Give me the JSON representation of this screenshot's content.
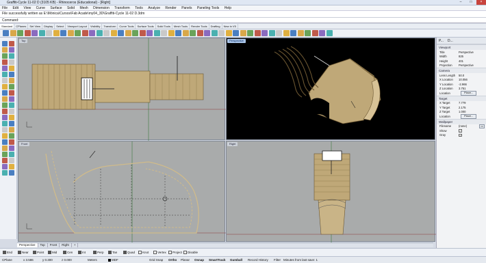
{
  "window": {
    "title": "Graffiti-Cycle 11-02 D (3105 KB) - Rhinoceros (Educational) - [Right]",
    "buttons": [
      "–",
      "□",
      "×"
    ]
  },
  "menu": [
    "File",
    "Edit",
    "View",
    "Curve",
    "Surface",
    "Solid",
    "Mesh",
    "Dimension",
    "Transform",
    "Tools",
    "Analyze",
    "Render",
    "Panels",
    "Paneling Tools",
    "Help"
  ],
  "command": {
    "history": "File successfully written as E:\\Mónica\\Cursos\\Fab Acade\\my04_3D\\Graffiti-Cycle 11-02 D.3dm",
    "prompt": "Command:"
  },
  "tabs": [
    "Standard",
    "CPlanes",
    "Set View",
    "Display",
    "Select",
    "Viewport Layout",
    "Visibility",
    "Transform",
    "Curve Tools",
    "Surface Tools",
    "Solid Tools",
    "Mesh Tools",
    "Render Tools",
    "Drafting",
    "New in V5"
  ],
  "viewports": {
    "top": "Top",
    "perspective": "Perspective",
    "front": "Front",
    "right": "Right"
  },
  "viewport_tabs": [
    "Perspective",
    "Top",
    "Front",
    "Right",
    "+"
  ],
  "osnaps": [
    {
      "label": "End",
      "on": true
    },
    {
      "label": "Near",
      "on": true
    },
    {
      "label": "Point",
      "on": true
    },
    {
      "label": "Mid",
      "on": true
    },
    {
      "label": "Cen",
      "on": true
    },
    {
      "label": "Int",
      "on": true
    },
    {
      "label": "Perp",
      "on": true
    },
    {
      "label": "Tan",
      "on": true
    },
    {
      "label": "Quad",
      "on": true
    },
    {
      "label": "Knot",
      "on": false
    },
    {
      "label": "Vertex",
      "on": false
    },
    {
      "label": "Project",
      "on": false
    },
    {
      "label": "Disable",
      "on": false
    }
  ],
  "status": {
    "cplane": "CPlane",
    "x": "x 3.586",
    "y": "y 0.300",
    "z": "z 0.000",
    "units": "Meters",
    "layer": "MDF",
    "grid_snap": "Grid Snap",
    "ortho": "Ortho",
    "planar": "Planar",
    "osnap": "Osnap",
    "smarttrack": "SmartTrack",
    "gumball": "Gumball",
    "record": "Record History",
    "filter": "Filter",
    "save": "Minutes from last save: 1"
  },
  "panel": {
    "viewport_section": "Viewport",
    "title_k": "Title",
    "title_v": "Perspective",
    "width_k": "Width",
    "width_v": "825",
    "height_k": "Height",
    "height_v": "401",
    "projection_k": "Projection",
    "projection_v": "Perspective",
    "camera_section": "Camera",
    "lens_k": "Lens Length",
    "lens_v": "50.0",
    "xloc_k": "X Location",
    "xloc_v": "10.056",
    "yloc_k": "Y Location",
    "yloc_v": "-2.966",
    "zloc_k": "Z Location",
    "zloc_v": "3.751",
    "loc_k": "Location",
    "place1": "Place...",
    "target_section": "Target",
    "xt_k": "X Target",
    "xt_v": "7.779",
    "yt_k": "Y Target",
    "yt_v": "2.175",
    "zt_k": "Z Target",
    "zt_v": "1.000",
    "tloc_k": "Location",
    "place2": "Place...",
    "wallpaper_section": "Wallpaper",
    "file_k": "Filename",
    "file_v": "(none)",
    "show_k": "Show",
    "gray_k": "Gray",
    "tab1": "P...",
    "tab2": "D..."
  },
  "colors": {
    "viewport_bg": "#a9abab",
    "perspective_bg": "#000000",
    "wood": "#bfa878",
    "wood_dark": "#8a7448",
    "active_label": "#a9c4e8"
  }
}
